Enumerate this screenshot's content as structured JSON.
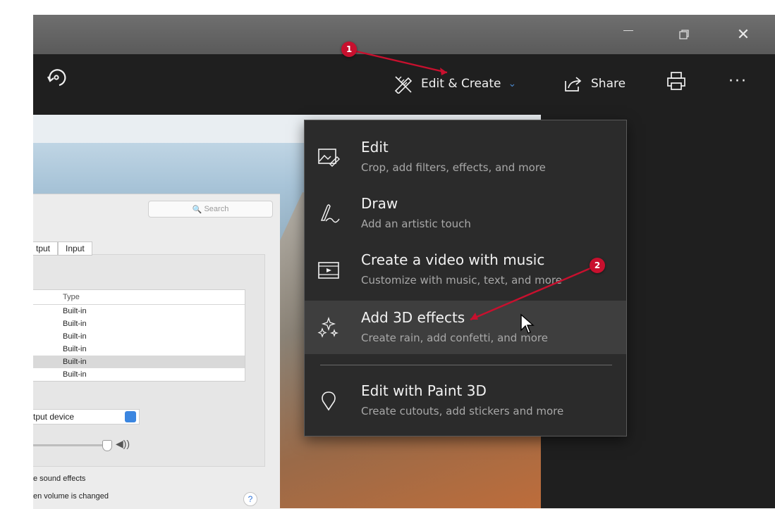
{
  "window": {
    "minimize_label": "—",
    "restore_label": "❐",
    "close_label": "✕"
  },
  "toolbar": {
    "edit_create_label": "Edit & Create",
    "share_label": "Share",
    "more_label": "···"
  },
  "menu": {
    "items": [
      {
        "title": "Edit",
        "subtitle": "Crop, add filters, effects, and more",
        "icon": "edit-photo-icon"
      },
      {
        "title": "Draw",
        "subtitle": "Add an artistic touch",
        "icon": "draw-pen-icon"
      },
      {
        "title": "Create a video with music",
        "subtitle": "Customize with music, text, and more",
        "icon": "video-icon"
      },
      {
        "title": "Add 3D effects",
        "subtitle": "Create rain, add confetti, and more",
        "icon": "sparkle-3d-icon"
      },
      {
        "title": "Edit with Paint 3D",
        "subtitle": "Create cutouts, add stickers and more",
        "icon": "paint3d-icon"
      }
    ],
    "highlighted_item": "Add 3D effects"
  },
  "annotations": {
    "badge1": "1",
    "badge2": "2",
    "badge_color": "#c8102e"
  },
  "mac_sound": {
    "search_placeholder": "Search",
    "tab_output": "tput",
    "tab_input": "Input",
    "table_header": "Type",
    "rows": [
      "Built-in",
      "Built-in",
      "Built-in",
      "Built-in",
      "Built-in",
      "Built-in"
    ],
    "selected_row_index": 4,
    "device_select": "tput device",
    "line1": "e sound effects",
    "line2": "en volume is changed",
    "help": "?"
  },
  "colors": {
    "toolbar_bg": "#1f1f1f",
    "menu_bg": "#2b2b2b",
    "accent": "#4a86c8"
  }
}
